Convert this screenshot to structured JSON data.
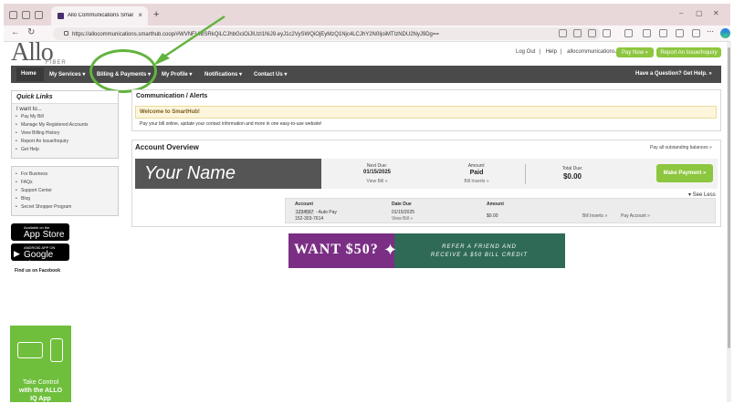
{
  "browser": {
    "tab_title": "Allo Communications SmartHub",
    "url": "https://allocommunications.smarthub.coop/#WVNFUlBSRkQiLCJhbGciOiJIUzI1NiJ9.eyJ1c2VySWQiOjEyMzQ1Njc4LCJhY2N0IjoiMTIzNDU2NyJ9Dg==",
    "tab_close": "×",
    "new_tab": "+",
    "win_min": "–",
    "win_max": "▢",
    "win_close": "✕",
    "back": "←",
    "refresh": "↻"
  },
  "header": {
    "logo": "Allo",
    "logo_sub": "FIBER",
    "logout": "Log Out",
    "help": "Help",
    "email": "allocommunications.com",
    "pay_now": "Pay Now »",
    "report_issue": "Report An Issue/Inquiry"
  },
  "nav": {
    "home": "Home",
    "my_services": "My Services ▾",
    "billing": "Billing & Payments ▾",
    "my_profile": "My Profile ▾",
    "notifications": "Notifications ▾",
    "contact_us": "Contact Us ▾",
    "question": "Have a Question? Get Help. »"
  },
  "quick_links": {
    "title": "Quick Links",
    "want_to": "I want to...",
    "items": [
      "Pay My Bill",
      "Manage My Registered Accounts",
      "View Billing History",
      "Report An Issue/Inquiry",
      "Get Help"
    ]
  },
  "secondary_links": {
    "items": [
      "For Business",
      "FAQs",
      "Support Center",
      "Blog",
      "Secret Shopper Program"
    ]
  },
  "stores": {
    "apple_small": "Available on the",
    "apple_big": "App Store",
    "google_small": "ANDROID APP ON",
    "google_big": "Google play",
    "facebook": "Find us on Facebook"
  },
  "promo_app": {
    "line1": "Take Control",
    "line2": "with the ALLO",
    "line3": "IQ App"
  },
  "alerts": {
    "title": "Communication / Alerts",
    "welcome": "Welcome to SmartHub!",
    "intro": "Pay your bill online, update your contact information and more in one easy-to-use website!"
  },
  "overview": {
    "title": "Account Overview",
    "pay_all": "Pay all outstanding balances »",
    "name": "Your Name",
    "next_due_label": "Next Due:",
    "next_due_value": "01/15/2025",
    "view_bill": "View Bill »",
    "amount_label": "Amount:",
    "amount_value": "Paid",
    "bill_inserts": "Bill Inserts »",
    "total_due_label": "Total Due:",
    "total_due_value": "$0.00",
    "make_payment": "Make Payment »",
    "see_less": "▾ See Less"
  },
  "account_table": {
    "headers": [
      "Account",
      "Date Due",
      "Amount"
    ],
    "row": {
      "account_no": "1234567",
      "account_suffix": " - Auto Pay",
      "phone": "152-303-7614",
      "date_due": "01/15/2025",
      "view_bill": "View Bill »",
      "amount": "$0.00",
      "bill_inserts": "Bill Inserts »",
      "pay_account": "Pay Account »"
    }
  },
  "banner": {
    "want": "WANT $50?",
    "refer_line1": "REFER A FRIEND AND",
    "refer_line2": "RECEIVE A $50 BILL CREDIT"
  },
  "colors": {
    "accent_green": "#8dc63f",
    "nav_dark": "#4a4a4a",
    "annotation": "#62b33e",
    "banner_purple": "#7a2f84",
    "banner_teal": "#2f6a56"
  }
}
